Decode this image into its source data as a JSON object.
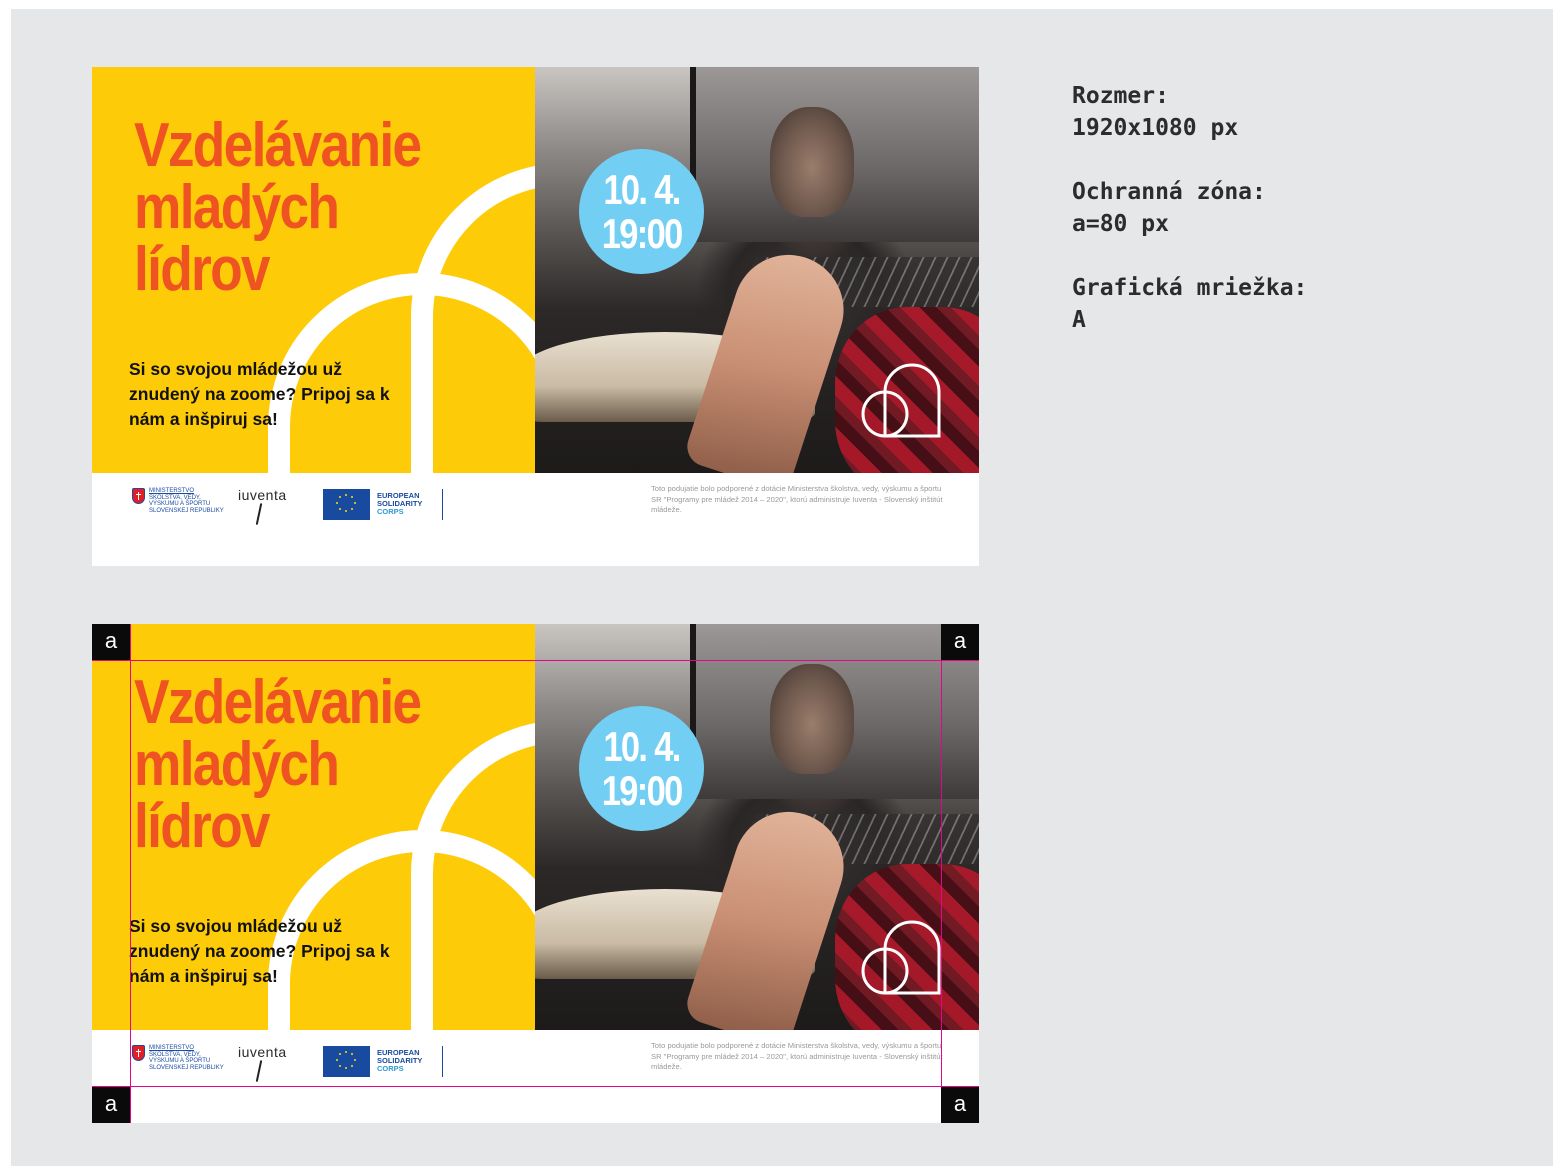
{
  "banner": {
    "title_lines": [
      "Vzdelávanie",
      "mladých",
      "lídrov"
    ],
    "lead": "Si so svojou mládežou už znudený na zoome? Pripoj sa k nám a inšpiruj sa!",
    "date": "10. 4.",
    "time": "19:00",
    "brand_icon": "iuventa-arch-icon",
    "footer": {
      "ministry_lines": [
        "MINISTERSTVO",
        "ŠKOLSTVA, VEDY,",
        "VÝSKUMU A ŠPORTU",
        "SLOVENSKEJ REPUBLIKY"
      ],
      "iuventa_logo": "iuventa",
      "esc_lines": [
        "EUROPEAN",
        "SOLIDARITY",
        "CORPS"
      ],
      "disclaimer": "Toto podujatie bolo podporené z dotácie Ministerstva školstva, vedy, výskumu a športu SR \"Programy pre mládež 2014 – 2020\", ktorú administruje Iuventa - Slovenský inštitút mládeže."
    }
  },
  "specs": {
    "size_label": "Rozmer:",
    "size_value": "1920x1080 px",
    "zone_label": "Ochranná zóna:",
    "zone_value": "a=80 px",
    "grid_label": "Grafická mriežka:",
    "grid_value": "A"
  },
  "guide_marker": "a",
  "colors": {
    "yellow": "#fdcb08",
    "orange_title": "#ef5322",
    "date_blue": "#72cff3",
    "guide_magenta": "#e4058c",
    "eu_blue": "#184a9f",
    "background": "#e6e7e8"
  }
}
